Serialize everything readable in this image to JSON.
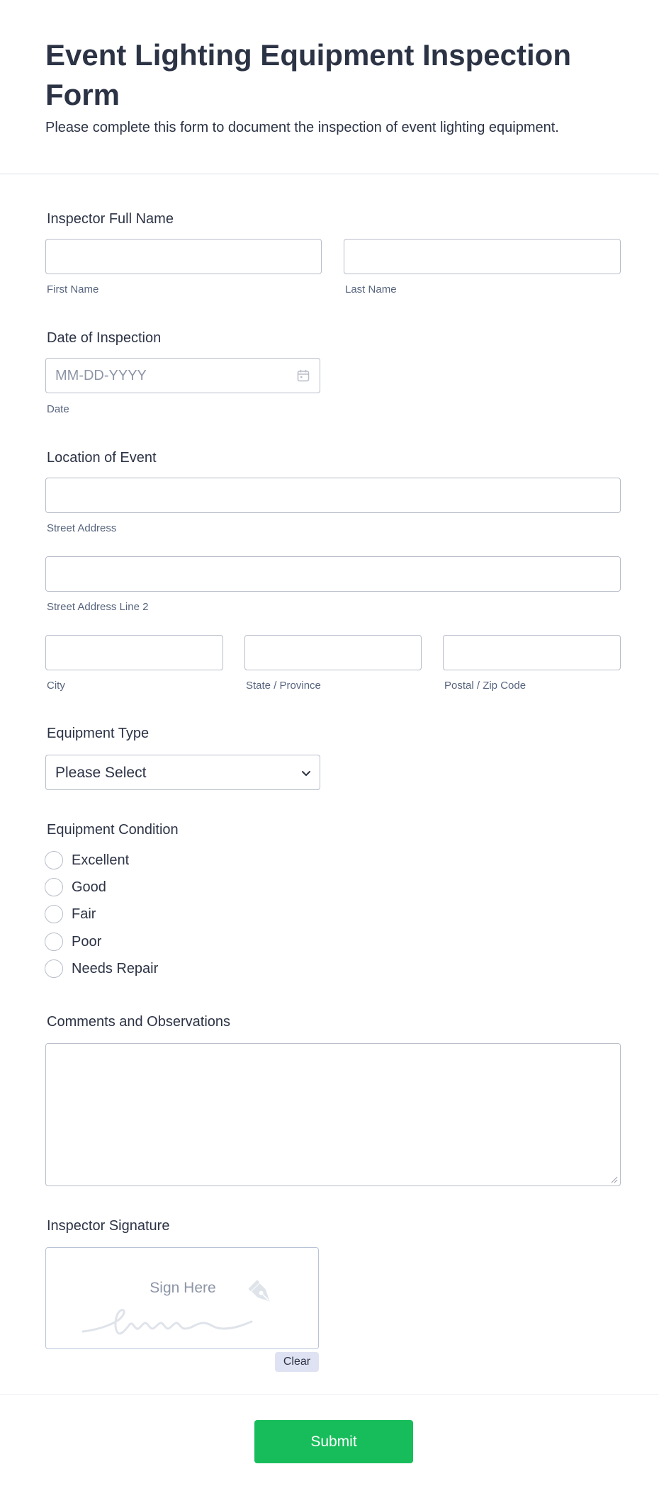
{
  "header": {
    "title": "Event Lighting Equipment Inspection Form",
    "subtitle": "Please complete this form to document the inspection of event lighting equipment."
  },
  "inspector_name": {
    "label": "Inspector Full Name",
    "first_value": "",
    "first_sublabel": "First Name",
    "last_value": "",
    "last_sublabel": "Last Name"
  },
  "inspection_date": {
    "label": "Date of Inspection",
    "placeholder": "MM-DD-YYYY",
    "sublabel": "Date",
    "icon": "calendar-icon"
  },
  "location": {
    "label": "Location of Event",
    "street_sublabel": "Street Address",
    "street2_sublabel": "Street Address Line 2",
    "city_sublabel": "City",
    "state_sublabel": "State / Province",
    "postal_sublabel": "Postal / Zip Code"
  },
  "equipment_type": {
    "label": "Equipment Type",
    "selected": "Please Select",
    "icon": "chevron-down-icon"
  },
  "equipment_condition": {
    "label": "Equipment Condition",
    "options": [
      "Excellent",
      "Good",
      "Fair",
      "Poor",
      "Needs Repair"
    ]
  },
  "comments": {
    "label": "Comments and Observations",
    "value": ""
  },
  "signature": {
    "label": "Inspector Signature",
    "placeholder": "Sign Here",
    "clear_label": "Clear",
    "icon": "pen-nib-icon"
  },
  "submit": {
    "label": "Submit"
  },
  "colors": {
    "text": "#2c3345",
    "sublabel": "#57647e",
    "border": "#b8bdc9",
    "submit": "#18bd5b",
    "clear_bg": "#dfe2f2"
  }
}
